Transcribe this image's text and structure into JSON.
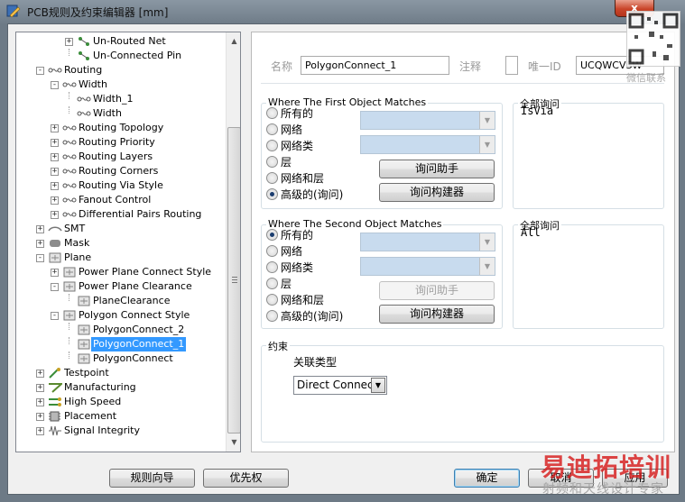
{
  "window": {
    "title": "PCB规则及约束编辑器 [mm]",
    "close_label": "x"
  },
  "tree": {
    "items": [
      {
        "label": "Un-Routed Net",
        "icon": "rule-icon"
      },
      {
        "label": "Un-Connected Pin",
        "icon": "rule-icon"
      },
      {
        "label": "Routing",
        "icon": "routing-icon"
      },
      {
        "label": "Width",
        "icon": "routing-icon"
      },
      {
        "label": "Width_1",
        "icon": "routing-icon"
      },
      {
        "label": "Width",
        "icon": "routing-icon"
      },
      {
        "label": "Routing Topology",
        "icon": "routing-icon"
      },
      {
        "label": "Routing Priority",
        "icon": "routing-icon"
      },
      {
        "label": "Routing Layers",
        "icon": "routing-icon"
      },
      {
        "label": "Routing Corners",
        "icon": "routing-icon"
      },
      {
        "label": "Routing Via Style",
        "icon": "routing-icon"
      },
      {
        "label": "Fanout Control",
        "icon": "routing-icon"
      },
      {
        "label": "Differential Pairs Routing",
        "icon": "routing-icon"
      },
      {
        "label": "SMT",
        "icon": "smt-icon"
      },
      {
        "label": "Mask",
        "icon": "mask-icon"
      },
      {
        "label": "Plane",
        "icon": "plane-icon"
      },
      {
        "label": "Power Plane Connect Style",
        "icon": "plane-icon"
      },
      {
        "label": "Power Plane Clearance",
        "icon": "plane-icon"
      },
      {
        "label": "PlaneClearance",
        "icon": "plane-icon"
      },
      {
        "label": "Polygon Connect Style",
        "icon": "plane-icon"
      },
      {
        "label": "PolygonConnect_2",
        "icon": "plane-icon"
      },
      {
        "label": "PolygonConnect_1",
        "icon": "plane-icon",
        "selected": true
      },
      {
        "label": "PolygonConnect",
        "icon": "plane-icon"
      },
      {
        "label": "Testpoint",
        "icon": "testpoint-icon"
      },
      {
        "label": "Manufacturing",
        "icon": "manufacturing-icon"
      },
      {
        "label": "High Speed",
        "icon": "highspeed-icon"
      },
      {
        "label": "Placement",
        "icon": "placement-icon"
      },
      {
        "label": "Signal Integrity",
        "icon": "signal-icon"
      }
    ]
  },
  "rule": {
    "name_label": "名称",
    "name_value": "PolygonConnect_1",
    "comment_label": "注释",
    "unique_id_label": "唯一ID",
    "unique_id_value": "UCQWCVSW"
  },
  "first_match": {
    "title": "Where The First Object Matches",
    "options": [
      "所有的",
      "网络",
      "网络类",
      "层",
      "网络和层",
      "高级的(询问)"
    ],
    "selected": "高级的(询问)",
    "query_helper": "询问助手",
    "query_builder": "询问构建器",
    "full_query_label": "全部询问",
    "full_query": "IsVia"
  },
  "second_match": {
    "title": "Where The Second Object Matches",
    "options": [
      "所有的",
      "网络",
      "网络类",
      "层",
      "网络和层",
      "高级的(询问)"
    ],
    "selected": "所有的",
    "query_helper": "询问助手",
    "query_builder": "询问构建器",
    "full_query_label": "全部询问",
    "full_query": "All"
  },
  "constraints": {
    "title": "约束",
    "connect_type_label": "关联类型",
    "connect_type_value": "Direct Connect"
  },
  "footer": {
    "rule_wizard": "规则向导",
    "priorities": "优先权",
    "ok": "确定",
    "cancel": "取消",
    "apply": "应用"
  },
  "watermark": {
    "main": "易迪拓培训",
    "sub": "射频和天线设计专家",
    "corner": "微信联系"
  },
  "colors": {
    "selection": "#3399ff",
    "combo_disabled": "#c8dbee",
    "window_frame": "#6d7a86",
    "close_button": "#c9452a"
  }
}
